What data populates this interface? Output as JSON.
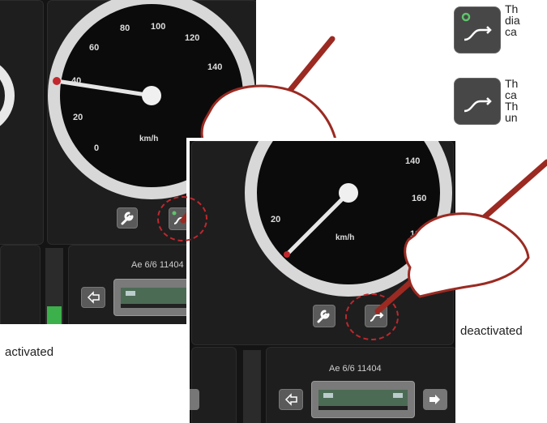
{
  "label_activated": "activated",
  "label_deactivated": "deactivated",
  "loco_name": "Ae 6/6 11404",
  "speed_unit": "km/h",
  "activated_speed_marks": [
    "0",
    "20",
    "40",
    "60",
    "80",
    "100",
    "120",
    "140"
  ],
  "deactivated_speed_marks": [
    "20",
    "140",
    "160",
    "180"
  ],
  "legend": [
    {
      "text": "Th\ndia\nca"
    },
    {
      "text": "Th\nca\nTh\nun"
    }
  ],
  "colors": {
    "needle_red": "#c1272d",
    "pen": "#9b2a22"
  }
}
